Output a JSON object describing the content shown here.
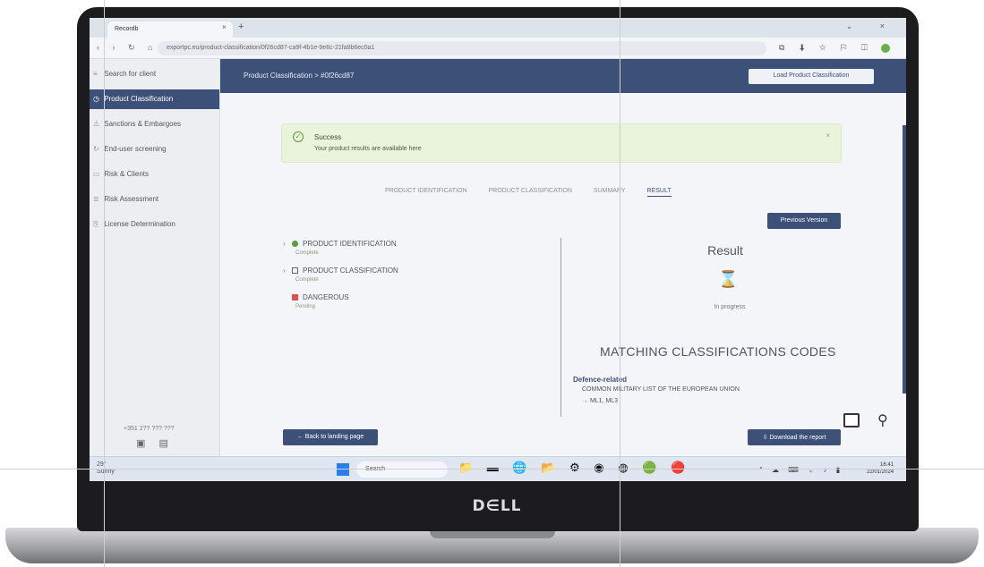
{
  "browser": {
    "tab_title": "Recordb",
    "tab_close": "×",
    "new_tab": "+",
    "window_controls": "⌄ ×",
    "nav_icons": "‹ › ↻ ⌂",
    "url": "exportpc.eu/product-classification/0f26cd87-ca9f-4b1e-9e6c-21fa8b6ec0a1",
    "ext_icons": "⧉ ⬇ ☆ ⚐ ◫"
  },
  "sidebar": {
    "items": [
      {
        "icon": "≡",
        "label": "Search for client"
      },
      {
        "icon": "◷",
        "label": "Product Classification"
      },
      {
        "icon": "⚠",
        "label": "Sanctions & Embargoes"
      },
      {
        "icon": "↻",
        "label": "End-user screening"
      },
      {
        "icon": "▭",
        "label": "Risk & Clients"
      },
      {
        "icon": "≣",
        "label": "Risk Assessment"
      },
      {
        "icon": "⎘",
        "label": "License Determination"
      }
    ],
    "footer_text": "+351 2?? ??? ???",
    "footer_icons": "▣ ▤"
  },
  "header": {
    "title": "Product Classification > #0f26cd87",
    "load_button": "Load Product Classification"
  },
  "alert": {
    "icon": "✓",
    "title": "Success",
    "text": "Your product results are available here",
    "close": "×"
  },
  "steps": [
    {
      "label": "PRODUCT IDENTIFICATION",
      "current": false
    },
    {
      "label": "PRODUCT CLASSIFICATION",
      "current": false
    },
    {
      "label": "SUMMARY",
      "current": false
    },
    {
      "label": "RESULT",
      "current": true
    }
  ],
  "previous_button": "Previous Version",
  "tree": [
    {
      "arrow": "›",
      "marker": "dot",
      "label": "PRODUCT IDENTIFICATION",
      "sub": "Complete"
    },
    {
      "arrow": "›",
      "marker": "square",
      "label": "PRODUCT CLASSIFICATION",
      "sub": "Complete"
    },
    {
      "arrow": "",
      "marker": "red",
      "label": "DANGEROUS",
      "sub": "Pending"
    }
  ],
  "result": {
    "title": "Result",
    "icon": "⌛",
    "status": "In progress"
  },
  "matching": {
    "title": "MATCHING CLASSIFICATIONS CODES",
    "category": "Defence-related",
    "list_name": "COMMON MILITARY LIST OF THE EUROPEAN UNION",
    "code": "→ ML1, ML3"
  },
  "buttons": {
    "back": "← Back to landing page",
    "download": "⇩ Download the report"
  },
  "taskbar": {
    "weather_temp": "29°",
    "weather_text": "Sunny",
    "search": "Search",
    "apps": "📁 ▬ 🌐 📂 ⚙ ◉ ◍ 🟢 🔴",
    "tray": "^ ☁ ⌨ ᯤ ♪ ▮",
    "time": "16:41",
    "date": "22/01/2024"
  },
  "brand": "D∈LL",
  "colors": {
    "primary": "#3d5178",
    "success_bg": "#eaf4dc",
    "success": "#5a9b3c"
  }
}
